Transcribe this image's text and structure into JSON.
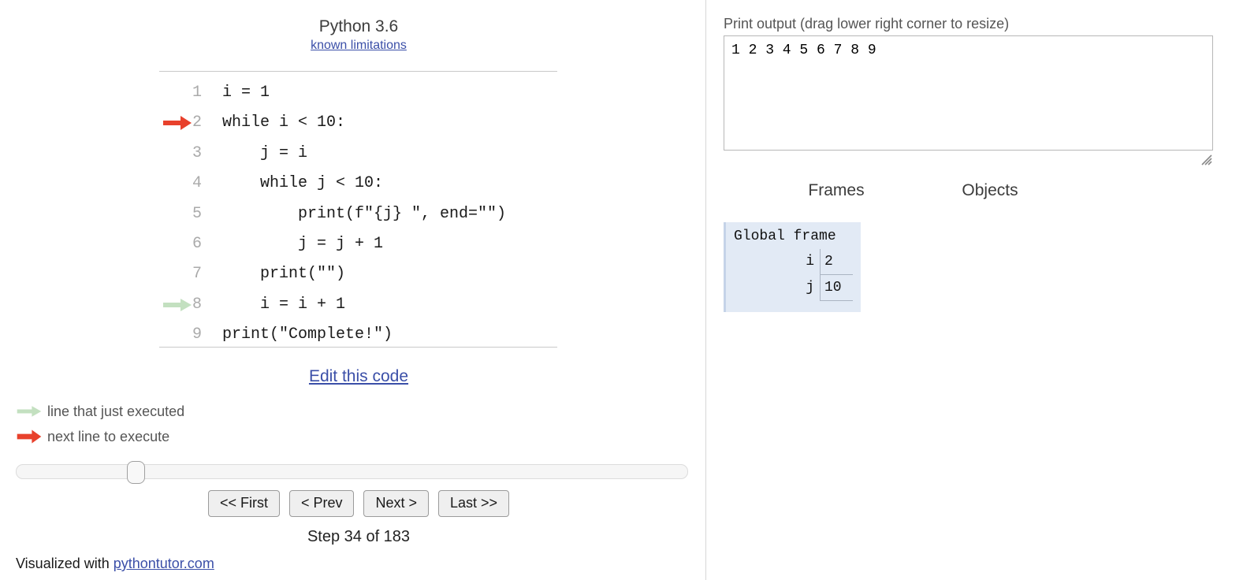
{
  "colors": {
    "next_line_arrow": "#e8412c",
    "just_executed_arrow": "#c3e0c0",
    "link": "#3b4fa8",
    "frame_background": "#e2eaf5",
    "frame_border": "#c5d3e8"
  },
  "left": {
    "language_title": "Python 3.6",
    "known_limitations_link": "known limitations",
    "code_lines": [
      {
        "number": "1",
        "text": "i = 1",
        "marker": "none"
      },
      {
        "number": "2",
        "text": "while i < 10:",
        "marker": "next"
      },
      {
        "number": "3",
        "text": "    j = i",
        "marker": "none"
      },
      {
        "number": "4",
        "text": "    while j < 10:",
        "marker": "none"
      },
      {
        "number": "5",
        "text": "        print(f\"{j} \", end=\"\")",
        "marker": "none"
      },
      {
        "number": "6",
        "text": "        j = j + 1",
        "marker": "none"
      },
      {
        "number": "7",
        "text": "    print(\"\")",
        "marker": "none"
      },
      {
        "number": "8",
        "text": "    i = i + 1",
        "marker": "executed"
      },
      {
        "number": "9",
        "text": "print(\"Complete!\")",
        "marker": "none"
      }
    ],
    "edit_code_link": "Edit this code",
    "legend": [
      {
        "label": "line that just executed",
        "marker": "executed"
      },
      {
        "label": "next line to execute",
        "marker": "next"
      }
    ],
    "slider": {
      "value_percent": 17
    },
    "nav_buttons": [
      {
        "label": "<< First",
        "name": "first-button"
      },
      {
        "label": "< Prev",
        "name": "prev-button"
      },
      {
        "label": "Next >",
        "name": "next-button"
      },
      {
        "label": "Last >>",
        "name": "last-button"
      }
    ],
    "step_label": "Step 34 of 183",
    "footer": {
      "prefix": "Visualized with ",
      "link": "pythontutor.com"
    }
  },
  "right": {
    "print_output_label": "Print output (drag lower right corner to resize)",
    "print_output_value": "1 2 3 4 5 6 7 8 9",
    "columns": {
      "frames": "Frames",
      "objects": "Objects"
    },
    "frames": [
      {
        "title": "Global frame",
        "variables": [
          {
            "name": "i",
            "value": "2"
          },
          {
            "name": "j",
            "value": "10"
          }
        ]
      }
    ]
  }
}
